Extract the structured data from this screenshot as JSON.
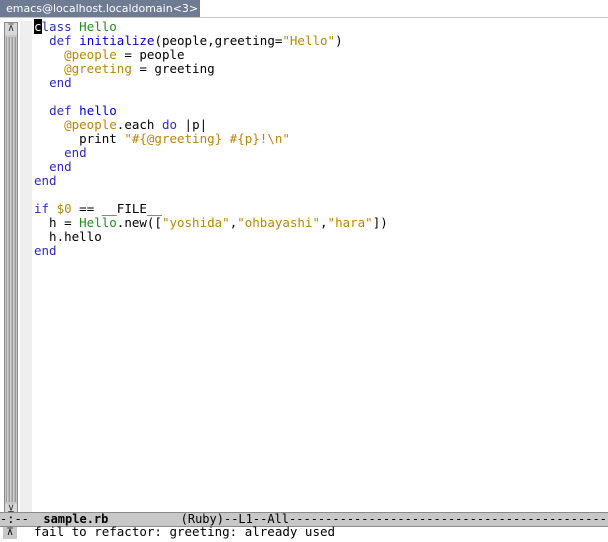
{
  "window": {
    "title": "emacs@localhost.localdomain<3>"
  },
  "editor": {
    "lines": [
      [
        {
          "t": "c",
          "c": "cursor"
        },
        {
          "t": "lass",
          "c": "kw"
        },
        {
          "t": " "
        },
        {
          "t": "Hello",
          "c": "cls"
        }
      ],
      [
        {
          "t": "  "
        },
        {
          "t": "def",
          "c": "kw"
        },
        {
          "t": " "
        },
        {
          "t": "initialize",
          "c": "fn"
        },
        {
          "t": "(people,greeting="
        },
        {
          "t": "\"Hello\"",
          "c": "str"
        },
        {
          "t": ")"
        }
      ],
      [
        {
          "t": "    "
        },
        {
          "t": "@people",
          "c": "ivar"
        },
        {
          "t": " = people"
        }
      ],
      [
        {
          "t": "    "
        },
        {
          "t": "@greeting",
          "c": "ivar"
        },
        {
          "t": " = greeting"
        }
      ],
      [
        {
          "t": "  "
        },
        {
          "t": "end",
          "c": "kw"
        }
      ],
      [
        {
          "t": ""
        }
      ],
      [
        {
          "t": "  "
        },
        {
          "t": "def",
          "c": "kw"
        },
        {
          "t": " "
        },
        {
          "t": "hello",
          "c": "fn"
        }
      ],
      [
        {
          "t": "    "
        },
        {
          "t": "@people",
          "c": "ivar"
        },
        {
          "t": ".each "
        },
        {
          "t": "do",
          "c": "kw"
        },
        {
          "t": " |p|"
        }
      ],
      [
        {
          "t": "      print "
        },
        {
          "t": "\"#{@greeting} #{p}!\\n\"",
          "c": "str"
        }
      ],
      [
        {
          "t": "    "
        },
        {
          "t": "end",
          "c": "kw"
        }
      ],
      [
        {
          "t": "  "
        },
        {
          "t": "end",
          "c": "kw"
        }
      ],
      [
        {
          "t": "end",
          "c": "kw"
        }
      ],
      [
        {
          "t": ""
        }
      ],
      [
        {
          "t": "if",
          "c": "kw"
        },
        {
          "t": " "
        },
        {
          "t": "$0",
          "c": "gvar"
        },
        {
          "t": " == __FILE__"
        }
      ],
      [
        {
          "t": "  h = "
        },
        {
          "t": "Hello",
          "c": "cls"
        },
        {
          "t": ".new(["
        },
        {
          "t": "\"yoshida\"",
          "c": "str"
        },
        {
          "t": ","
        },
        {
          "t": "\"ohbayashi\"",
          "c": "str"
        },
        {
          "t": ","
        },
        {
          "t": "\"hara\"",
          "c": "str"
        },
        {
          "t": "])"
        }
      ],
      [
        {
          "t": "  h.hello"
        }
      ],
      [
        {
          "t": "end",
          "c": "kw"
        }
      ]
    ]
  },
  "modeline": {
    "prefix": "-:--  ",
    "buffer_name": "sample.rb",
    "middle": "          (Ruby)--L1--All",
    "fill": "----------------------------------------------"
  },
  "minibuffer": {
    "message": "fail to refactor: greeting: already used"
  },
  "icons": {
    "scroll_up": "up-arrow-icon",
    "scroll_down": "down-arrow-icon"
  }
}
